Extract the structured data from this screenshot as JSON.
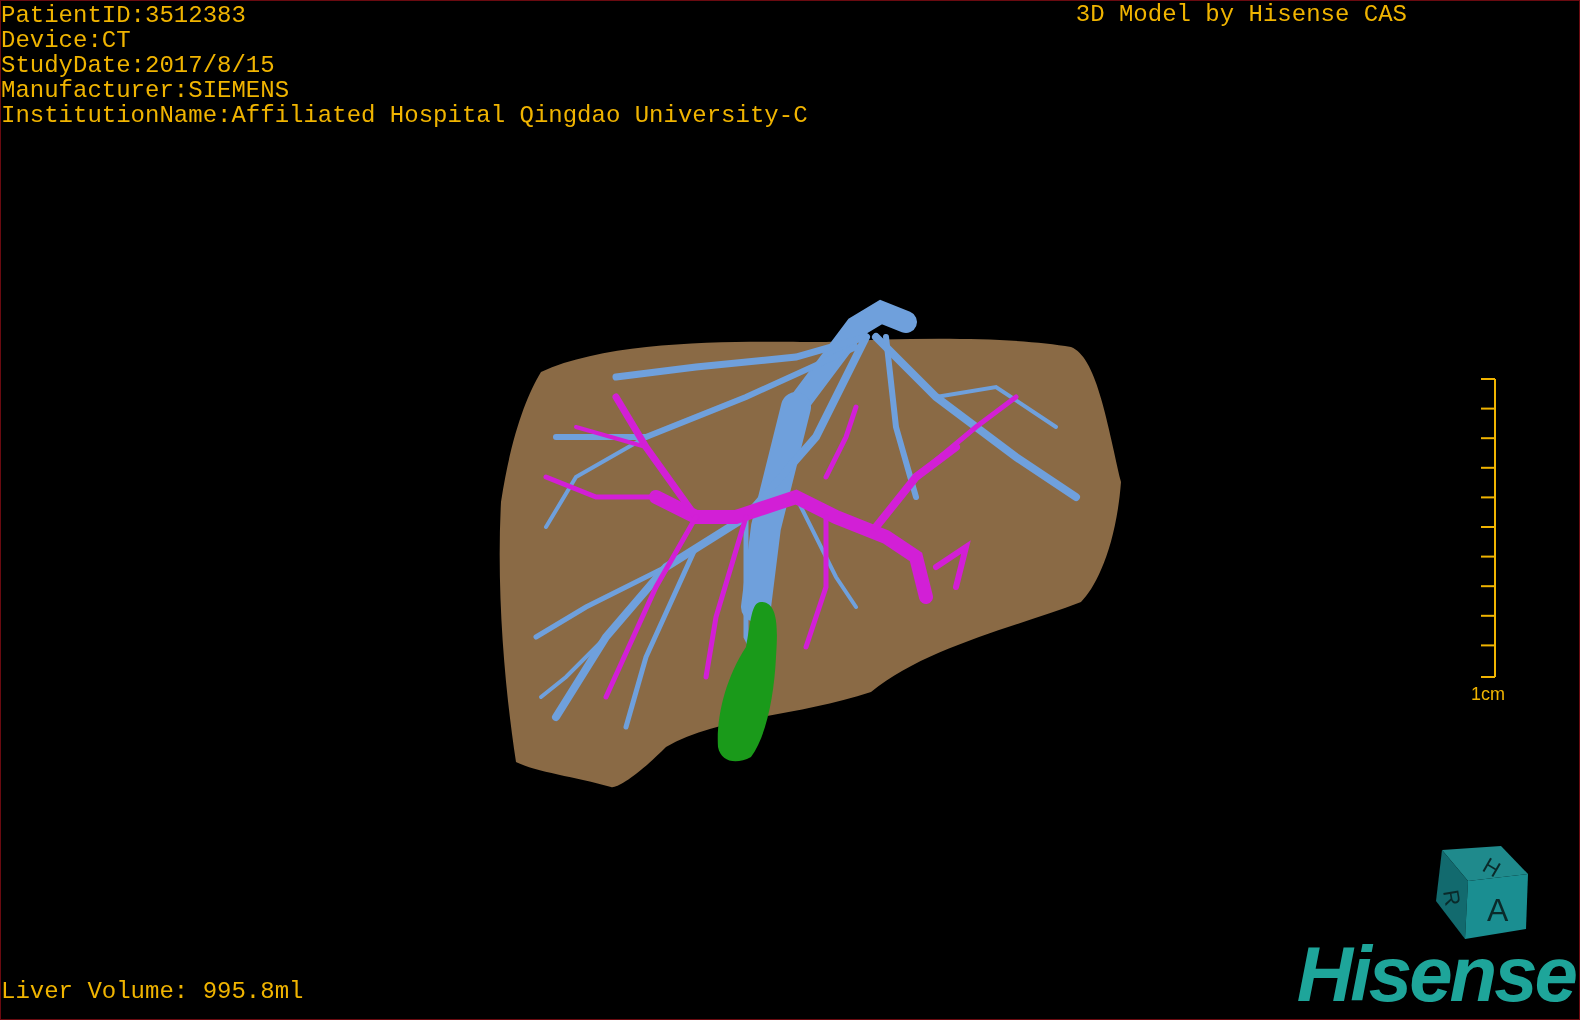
{
  "study_info": [
    "PatientID:3512383",
    "Device:CT",
    "StudyDate:2017/8/15",
    "Manufacturer:SIEMENS",
    "InstitutionName:Affiliated Hospital Qingdao University-C"
  ],
  "title": "3D Model by Hisense CAS",
  "scale_bar": {
    "label": "1cm"
  },
  "orientation_cube": {
    "top": "H",
    "left": "R",
    "front": "A"
  },
  "liver_volume": "Liver Volume: 995.8ml",
  "logo": "Hisense"
}
